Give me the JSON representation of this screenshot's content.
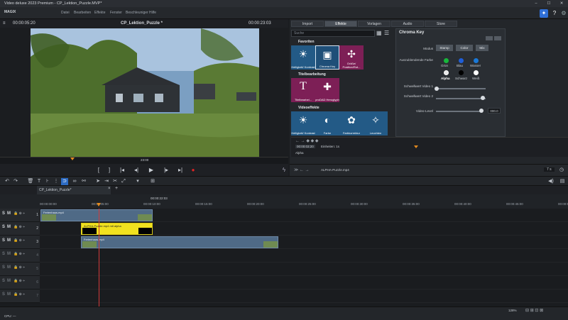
{
  "app": {
    "title": "Video deluxe 2023 Premium - CP_Lektion_Puzzle.MVP*",
    "logo": "MAGIX"
  },
  "menu": [
    "Datei",
    "Bearbeiten",
    "Effekte",
    "Fenster",
    "Beschleuniger",
    "Hilfe"
  ],
  "preview": {
    "time_left": "00:00:05:20",
    "project_name": "CP_Lektion_Puzzle *",
    "time_right": "00:00:23:03",
    "ruler_mark": "23:00"
  },
  "right_panel": {
    "tabs": [
      "Import",
      "Effekte",
      "Vorlagen",
      "Audio",
      "Store"
    ],
    "active_tab": "Effekte",
    "search_placeholder": "Suche",
    "sections": {
      "favorites": "Favoriten",
      "title_editing": "Titelbearbeitung",
      "video_effects": "Videoeffekte"
    },
    "favorite_tiles": [
      "Helligkeit/\nKontrast",
      "Chroma Key",
      "Größe/\nPosition/Rot..."
    ],
    "title_tiles": [
      "Titelbearbei...",
      "proDAD\nHeroglyph"
    ],
    "video_tiles": [
      "Helligkeit/\nKontrast",
      "Farbe",
      "Farbkorrektur",
      "Leuchten"
    ],
    "chroma_key": {
      "title": "Chroma Key",
      "mode_label": "Modus",
      "modes": [
        "Stamp",
        "Color",
        "Mix"
      ],
      "color_label": "Auszublendende Farbe",
      "colors": [
        {
          "name": "Grün",
          "color": "#17b83b"
        },
        {
          "name": "Blau",
          "color": "#1f5ed8"
        },
        {
          "name": "Wasser",
          "color": "#1a78d6"
        },
        {
          "name": "Alpha",
          "color": "#e8e8e8"
        },
        {
          "name": "Schwarz",
          "color": "#000000"
        },
        {
          "name": "Weiß",
          "color": "#ffffff"
        }
      ],
      "threshold1_label": "Schwellwert Video 1",
      "threshold2_label": "Schwellwert Video 2",
      "video_level_label": "Video-Level",
      "video_level_value": "000.0"
    },
    "kf_time": "00:00:03:20",
    "kf_label": "Einheiten: 1s",
    "kf_row": "Alpha",
    "footer_file": "ALPHA-Puzzle.mp4",
    "footer_value": "7 s"
  },
  "timeline": {
    "project_tab": "CP_Lektion_Puzzle*",
    "ruler_time": "00:00:22:03",
    "ruler_marks": [
      "00:00:00:00",
      "00:00:05:00",
      "00:00:10:00",
      "00:00:15:00",
      "00:00:20:00",
      "00:00:25:00",
      "00:00:30:00",
      "00:00:35:00",
      "00:00:40:00",
      "00:00:45:00",
      "00:00:50:00"
    ],
    "tracks": [
      {
        "num": "1",
        "clip": "Ferienhaus.mp4"
      },
      {
        "num": "2",
        "clip": "ALPHA-Puzzle.mp4 mit alpha"
      },
      {
        "num": "3",
        "clip": "Ferienhaus.mp4"
      },
      {
        "num": "4"
      },
      {
        "num": "5"
      },
      {
        "num": "6"
      },
      {
        "num": "7"
      }
    ]
  },
  "status": {
    "cpu": "CPU: —",
    "zoom": "128%"
  }
}
